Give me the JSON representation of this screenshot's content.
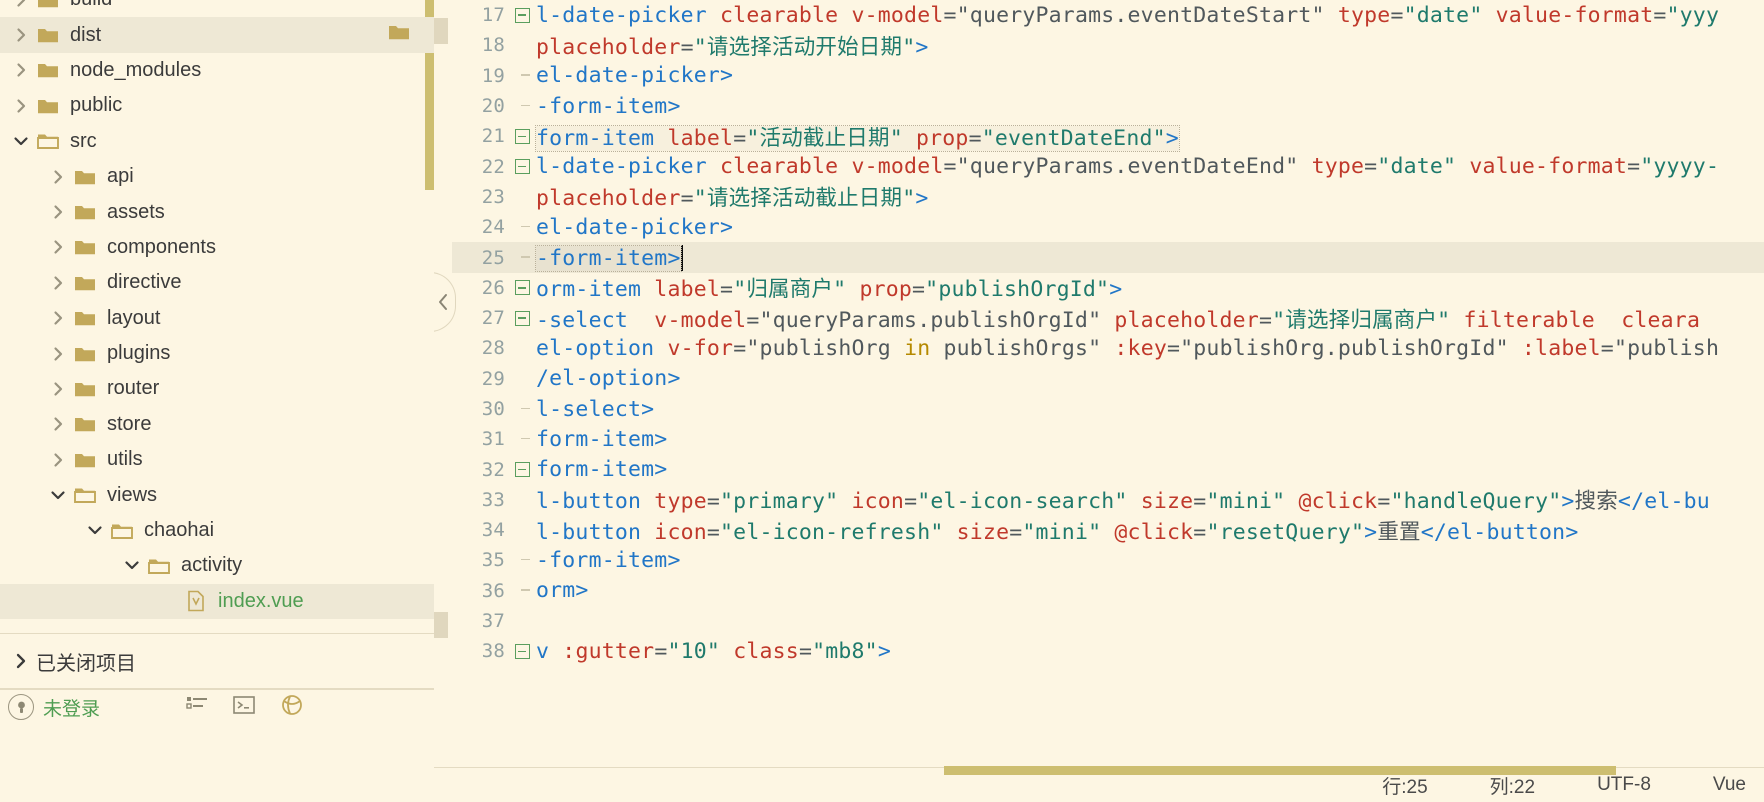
{
  "sidebar": {
    "tree": [
      {
        "label": "build",
        "indent": 0,
        "expanded": false,
        "type": "folder",
        "selected": false,
        "partial": true
      },
      {
        "label": "dist",
        "indent": 0,
        "expanded": false,
        "type": "folder",
        "selected": true,
        "right_icon": "folder-icon"
      },
      {
        "label": "node_modules",
        "indent": 0,
        "expanded": false,
        "type": "folder",
        "selected": false
      },
      {
        "label": "public",
        "indent": 0,
        "expanded": false,
        "type": "folder",
        "selected": false
      },
      {
        "label": "src",
        "indent": 0,
        "expanded": true,
        "type": "folder-open",
        "selected": false
      },
      {
        "label": "api",
        "indent": 1,
        "expanded": false,
        "type": "folder",
        "selected": false
      },
      {
        "label": "assets",
        "indent": 1,
        "expanded": false,
        "type": "folder",
        "selected": false
      },
      {
        "label": "components",
        "indent": 1,
        "expanded": false,
        "type": "folder",
        "selected": false
      },
      {
        "label": "directive",
        "indent": 1,
        "expanded": false,
        "type": "folder",
        "selected": false
      },
      {
        "label": "layout",
        "indent": 1,
        "expanded": false,
        "type": "folder",
        "selected": false
      },
      {
        "label": "plugins",
        "indent": 1,
        "expanded": false,
        "type": "folder",
        "selected": false
      },
      {
        "label": "router",
        "indent": 1,
        "expanded": false,
        "type": "folder",
        "selected": false
      },
      {
        "label": "store",
        "indent": 1,
        "expanded": false,
        "type": "folder",
        "selected": false
      },
      {
        "label": "utils",
        "indent": 1,
        "expanded": false,
        "type": "folder",
        "selected": false
      },
      {
        "label": "views",
        "indent": 1,
        "expanded": true,
        "type": "folder-open",
        "selected": false
      },
      {
        "label": "chaohai",
        "indent": 2,
        "expanded": true,
        "type": "folder-open",
        "selected": false
      },
      {
        "label": "activity",
        "indent": 3,
        "expanded": true,
        "type": "folder-open",
        "selected": false
      },
      {
        "label": "index.vue",
        "indent": 4,
        "expanded": null,
        "type": "vue-file",
        "selected": true
      }
    ],
    "closed_projects_label": "已关闭项目",
    "status": {
      "account_label": "未登录",
      "icons": [
        "todo-list-icon",
        "terminal-icon",
        "globe-icon"
      ]
    }
  },
  "editor": {
    "language": "Vue",
    "encoding": "UTF-8",
    "caret_line_label": "行:25",
    "caret_column_label": "列:22",
    "current_line": 25,
    "first_line": 17,
    "lines": [
      {
        "num": 17,
        "fold": "minus",
        "guide": "none",
        "tokens": [
          {
            "t": "tag",
            "v": "l-date-picker "
          },
          {
            "t": "attr",
            "v": "clearable"
          },
          {
            "t": "plain",
            "v": " "
          },
          {
            "t": "attr",
            "v": "v-model"
          },
          {
            "t": "plain",
            "v": "="
          },
          {
            "t": "plain",
            "v": "\"queryParams.eventDateStart\""
          },
          {
            "t": "plain",
            "v": " "
          },
          {
            "t": "attr",
            "v": "type"
          },
          {
            "t": "plain",
            "v": "="
          },
          {
            "t": "str",
            "v": "\"date\""
          },
          {
            "t": "plain",
            "v": " "
          },
          {
            "t": "attr",
            "v": "value-format"
          },
          {
            "t": "plain",
            "v": "="
          },
          {
            "t": "str",
            "v": "\"yyy"
          }
        ]
      },
      {
        "num": 18,
        "fold": "none",
        "guide": "line",
        "tokens": [
          {
            "t": "attr",
            "v": "placeholder"
          },
          {
            "t": "plain",
            "v": "="
          },
          {
            "t": "str",
            "v": "\"请选择活动开始日期\""
          },
          {
            "t": "punc",
            "v": ">"
          }
        ]
      },
      {
        "num": 19,
        "fold": "none",
        "guide": "end",
        "tokens": [
          {
            "t": "tag",
            "v": "el-date-picker>"
          }
        ]
      },
      {
        "num": 20,
        "fold": "none",
        "guide": "end",
        "tokens": [
          {
            "t": "tag",
            "v": "-form-item>"
          }
        ]
      },
      {
        "num": 21,
        "fold": "minus",
        "guide": "none",
        "boxed": true,
        "tokens": [
          {
            "t": "tag",
            "v": "form-item "
          },
          {
            "t": "attr",
            "v": "label"
          },
          {
            "t": "plain",
            "v": "="
          },
          {
            "t": "str",
            "v": "\"活动截止日期\""
          },
          {
            "t": "plain",
            "v": " "
          },
          {
            "t": "attr",
            "v": "prop"
          },
          {
            "t": "plain",
            "v": "="
          },
          {
            "t": "str",
            "v": "\"eventDateEnd\""
          },
          {
            "t": "punc",
            "v": ">"
          }
        ]
      },
      {
        "num": 22,
        "fold": "minus",
        "guide": "none",
        "tokens": [
          {
            "t": "tag",
            "v": "l-date-picker "
          },
          {
            "t": "attr",
            "v": "clearable"
          },
          {
            "t": "plain",
            "v": " "
          },
          {
            "t": "attr",
            "v": "v-model"
          },
          {
            "t": "plain",
            "v": "="
          },
          {
            "t": "plain",
            "v": "\"queryParams.eventDateEnd\""
          },
          {
            "t": "plain",
            "v": " "
          },
          {
            "t": "attr",
            "v": "type"
          },
          {
            "t": "plain",
            "v": "="
          },
          {
            "t": "str",
            "v": "\"date\""
          },
          {
            "t": "plain",
            "v": " "
          },
          {
            "t": "attr",
            "v": "value-format"
          },
          {
            "t": "plain",
            "v": "="
          },
          {
            "t": "str",
            "v": "\"yyyy-"
          }
        ]
      },
      {
        "num": 23,
        "fold": "none",
        "guide": "line",
        "tokens": [
          {
            "t": "attr",
            "v": "placeholder"
          },
          {
            "t": "plain",
            "v": "="
          },
          {
            "t": "str",
            "v": "\"请选择活动截止日期\""
          },
          {
            "t": "punc",
            "v": ">"
          }
        ]
      },
      {
        "num": 24,
        "fold": "none",
        "guide": "end",
        "tokens": [
          {
            "t": "tag",
            "v": "el-date-picker>"
          }
        ]
      },
      {
        "num": 25,
        "fold": "none",
        "guide": "end",
        "current": true,
        "boxed": true,
        "caret": true,
        "tokens": [
          {
            "t": "tag",
            "v": "-form-item>"
          }
        ]
      },
      {
        "num": 26,
        "fold": "minus",
        "guide": "none",
        "tokens": [
          {
            "t": "tag",
            "v": "orm-item "
          },
          {
            "t": "attr",
            "v": "label"
          },
          {
            "t": "plain",
            "v": "="
          },
          {
            "t": "str",
            "v": "\"归属商户\""
          },
          {
            "t": "plain",
            "v": " "
          },
          {
            "t": "attr",
            "v": "prop"
          },
          {
            "t": "plain",
            "v": "="
          },
          {
            "t": "str",
            "v": "\"publishOrgId\""
          },
          {
            "t": "punc",
            "v": ">"
          }
        ]
      },
      {
        "num": 27,
        "fold": "minus",
        "guide": "none",
        "tokens": [
          {
            "t": "tag",
            "v": "-select  "
          },
          {
            "t": "attr",
            "v": "v-model"
          },
          {
            "t": "plain",
            "v": "="
          },
          {
            "t": "plain",
            "v": "\"queryParams.publishOrgId\""
          },
          {
            "t": "plain",
            "v": " "
          },
          {
            "t": "attr",
            "v": "placeholder"
          },
          {
            "t": "plain",
            "v": "="
          },
          {
            "t": "str",
            "v": "\"请选择归属商户\""
          },
          {
            "t": "plain",
            "v": " "
          },
          {
            "t": "attr",
            "v": "filterable"
          },
          {
            "t": "plain",
            "v": "  "
          },
          {
            "t": "attr",
            "v": "cleara"
          }
        ]
      },
      {
        "num": 28,
        "fold": "none",
        "guide": "line",
        "tokens": [
          {
            "t": "tag",
            "v": "el-option "
          },
          {
            "t": "attr",
            "v": "v-for"
          },
          {
            "t": "plain",
            "v": "="
          },
          {
            "t": "plain",
            "v": "\"publishOrg "
          },
          {
            "t": "kw",
            "v": "in"
          },
          {
            "t": "plain",
            "v": " publishOrgs\""
          },
          {
            "t": "plain",
            "v": " "
          },
          {
            "t": "attr",
            "v": ":key"
          },
          {
            "t": "plain",
            "v": "="
          },
          {
            "t": "plain",
            "v": "\"publishOrg.publishOrgId\""
          },
          {
            "t": "plain",
            "v": " "
          },
          {
            "t": "attr",
            "v": ":label"
          },
          {
            "t": "plain",
            "v": "="
          },
          {
            "t": "plain",
            "v": "\"publish"
          }
        ]
      },
      {
        "num": 29,
        "fold": "none",
        "guide": "line",
        "tokens": [
          {
            "t": "tag",
            "v": "/el-option>"
          }
        ]
      },
      {
        "num": 30,
        "fold": "none",
        "guide": "end",
        "tokens": [
          {
            "t": "tag",
            "v": "l-select>"
          }
        ]
      },
      {
        "num": 31,
        "fold": "none",
        "guide": "end",
        "tokens": [
          {
            "t": "tag",
            "v": "form-item>"
          }
        ]
      },
      {
        "num": 32,
        "fold": "minus",
        "guide": "none",
        "tokens": [
          {
            "t": "tag",
            "v": "form-item>"
          }
        ]
      },
      {
        "num": 33,
        "fold": "none",
        "guide": "line",
        "tokens": [
          {
            "t": "tag",
            "v": "l-button "
          },
          {
            "t": "attr",
            "v": "type"
          },
          {
            "t": "plain",
            "v": "="
          },
          {
            "t": "str",
            "v": "\"primary\""
          },
          {
            "t": "plain",
            "v": " "
          },
          {
            "t": "attr",
            "v": "icon"
          },
          {
            "t": "plain",
            "v": "="
          },
          {
            "t": "str",
            "v": "\"el-icon-search\""
          },
          {
            "t": "plain",
            "v": " "
          },
          {
            "t": "attr",
            "v": "size"
          },
          {
            "t": "plain",
            "v": "="
          },
          {
            "t": "str",
            "v": "\"mini\""
          },
          {
            "t": "plain",
            "v": " "
          },
          {
            "t": "attr",
            "v": "@click"
          },
          {
            "t": "plain",
            "v": "="
          },
          {
            "t": "str",
            "v": "\"handleQuery\""
          },
          {
            "t": "punc",
            "v": ">"
          },
          {
            "t": "plain",
            "v": "搜索"
          },
          {
            "t": "tag",
            "v": "</el-bu"
          }
        ]
      },
      {
        "num": 34,
        "fold": "none",
        "guide": "line",
        "tokens": [
          {
            "t": "tag",
            "v": "l-button "
          },
          {
            "t": "attr",
            "v": "icon"
          },
          {
            "t": "plain",
            "v": "="
          },
          {
            "t": "str",
            "v": "\"el-icon-refresh\""
          },
          {
            "t": "plain",
            "v": " "
          },
          {
            "t": "attr",
            "v": "size"
          },
          {
            "t": "plain",
            "v": "="
          },
          {
            "t": "str",
            "v": "\"mini\""
          },
          {
            "t": "plain",
            "v": " "
          },
          {
            "t": "attr",
            "v": "@click"
          },
          {
            "t": "plain",
            "v": "="
          },
          {
            "t": "str",
            "v": "\"resetQuery\""
          },
          {
            "t": "punc",
            "v": ">"
          },
          {
            "t": "plain",
            "v": "重置"
          },
          {
            "t": "tag",
            "v": "</el-button>"
          }
        ]
      },
      {
        "num": 35,
        "fold": "none",
        "guide": "end",
        "tokens": [
          {
            "t": "tag",
            "v": "-form-item>"
          }
        ]
      },
      {
        "num": 36,
        "fold": "none",
        "guide": "end",
        "tokens": [
          {
            "t": "tag",
            "v": "orm>"
          }
        ]
      },
      {
        "num": 37,
        "fold": "none",
        "guide": "none",
        "tokens": []
      },
      {
        "num": 38,
        "fold": "minus",
        "guide": "none",
        "tokens": [
          {
            "t": "tag",
            "v": "v "
          },
          {
            "t": "attr",
            "v": ":gutter"
          },
          {
            "t": "plain",
            "v": "="
          },
          {
            "t": "str",
            "v": "\"10\""
          },
          {
            "t": "plain",
            "v": " "
          },
          {
            "t": "attr",
            "v": "class"
          },
          {
            "t": "plain",
            "v": "="
          },
          {
            "t": "str",
            "v": "\"mb8\""
          },
          {
            "t": "punc",
            "v": ">"
          }
        ]
      }
    ]
  },
  "colors": {
    "background": "#FDF6E3",
    "selection": "#EEE8D5",
    "scrollbar": "#CDBE70",
    "folder": "#C2A85A",
    "tag": "#2176C7",
    "attribute": "#C0392B",
    "string": "#1F7A6C",
    "keyword": "#B58900",
    "vue_green": "#4F9D52"
  }
}
